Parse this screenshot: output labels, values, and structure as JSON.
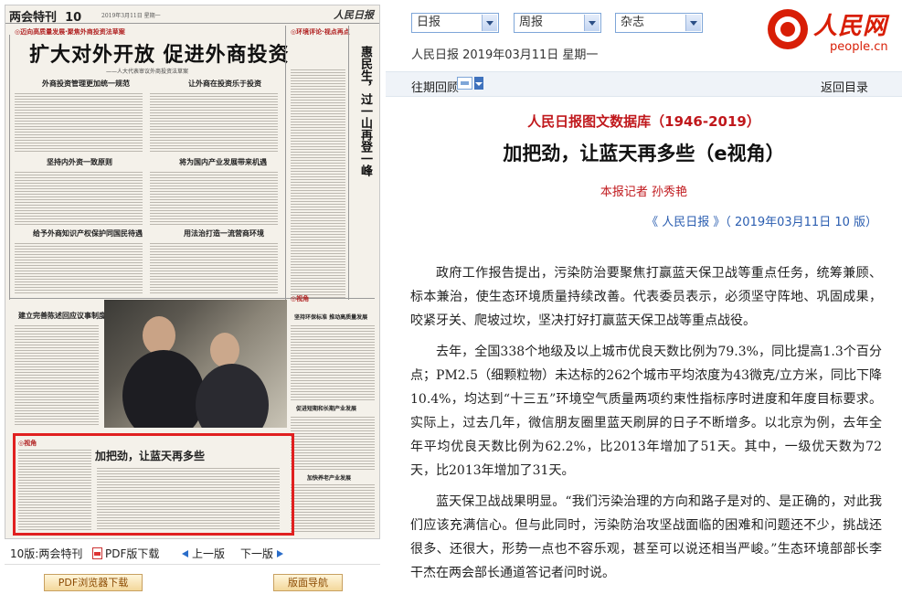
{
  "left": {
    "newspaper": {
      "section_label": "两会特刊",
      "page_num": "10",
      "date_line": "2019年3月11日 星期一",
      "masthead": "人民日报",
      "top_banner": "◎迈向高质量发展·聚焦外商投资法草案",
      "top_banner_right": "◎环境评论·视点再点",
      "headline": "扩大对外开放 促进外商投资",
      "subheadline": "——人大代表审议外商投资法草案",
      "sub_heads": [
        "外商投资管理更加统一规范",
        "让外商在投资乐于投资",
        "坚持内外资一致原则",
        "将为国内产业发展带来机遇",
        "给予外商知识产权保护同国民待遇",
        "用法治打造一流营商环境",
        "建立完善陈述回应议事制度",
        "坚持环保标准 推动高质量发展",
        "促进短期和长期产业发展",
        "加快养老产业发展"
      ],
      "vertical_headline": "惠民生，过一山再登一峰",
      "side_label": "◎视角",
      "side_label2": "◎视角",
      "highlight_headline": "加把劲，让蓝天再多些"
    },
    "nav": {
      "page_label": "10版:两会特刊",
      "pdf_download": "PDF版下载",
      "prev": "上一版",
      "next": "下一版"
    },
    "buttons": {
      "pdf_browser": "PDF浏览器下载",
      "page_nav": "版面导航"
    }
  },
  "right": {
    "selectors": [
      "日报",
      "周报",
      "杂志"
    ],
    "top_date": "人民日报 2019年03月11日 星期一",
    "logo": {
      "cn": "人民网",
      "en": "people.cn"
    },
    "nav": {
      "past": "往期回顾",
      "back": "返回目录"
    },
    "db_title": "人民日报图文数据库（1946-2019）",
    "article_title": "加把劲，让蓝天再多些（e视角）",
    "author": "本报记者 孙秀艳",
    "source": "《 人民日报 》（ 2019年03月11日   10 版）",
    "paragraphs": [
      "政府工作报告提出，污染防治要聚焦打赢蓝天保卫战等重点任务，统筹兼顾、标本兼治，使生态环境质量持续改善。代表委员表示，必须坚守阵地、巩固成果，咬紧牙关、爬坡过坎，坚决打好打赢蓝天保卫战等重点战役。",
      "去年，全国338个地级及以上城市优良天数比例为79.3%，同比提高1.3个百分点；PM2.5（细颗粒物）未达标的262个城市平均浓度为43微克/立方米，同比下降10.4%，均达到“十三五”环境空气质量两项约束性指标序时进度和年度目标要求。实际上，过去几年，微信朋友圈里蓝天刷屏的日子不断增多。以北京为例，去年全年平均优良天数比例为62.2%，比2013年增加了51天。其中，一级优天数为72天，比2013年增加了31天。",
      "蓝天保卫战战果明显。“我们污染治理的方向和路子是对的、是正确的，对此我们应该充满信心。但与此同时，污染防治攻坚战面临的困难和问题还不少，挑战还很多、还很大，形势一点也不容乐观，甚至可以说还相当严峻。”生态环境部部长李干杰在两会部长通道答记者问时说。"
    ]
  },
  "colors": {
    "brand_red": "#d81e06",
    "title_red": "#c0181c",
    "link_blue": "#2a5db0",
    "highlight_red": "#e02020"
  }
}
